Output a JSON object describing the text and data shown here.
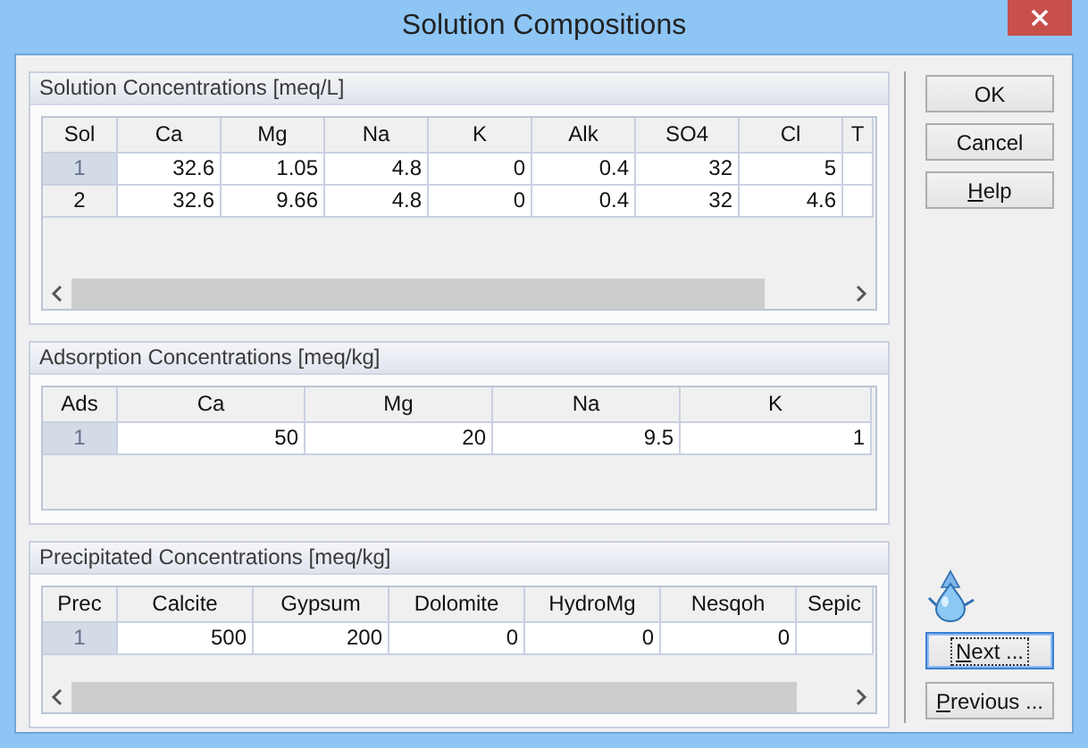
{
  "window": {
    "title": "Solution Compositions"
  },
  "panels": [
    {
      "title": "Solution Concentrations [meq/L]",
      "scrollbar": true,
      "columns": [
        "Sol",
        "Ca",
        "Mg",
        "Na",
        "K",
        "Alk",
        "SO4",
        "Cl",
        "T"
      ],
      "rows": [
        {
          "header": "1",
          "selected": true,
          "cells": [
            "32.6",
            "1.05",
            "4.8",
            "0",
            "0.4",
            "32",
            "5",
            ""
          ]
        },
        {
          "header": "2",
          "selected": false,
          "cells": [
            "32.6",
            "9.66",
            "4.8",
            "0",
            "0.4",
            "32",
            "4.6",
            ""
          ]
        }
      ]
    },
    {
      "title": "Adsorption Concentrations [meq/kg]",
      "scrollbar": false,
      "columns": [
        "Ads",
        "Ca",
        "Mg",
        "Na",
        "K"
      ],
      "rows": [
        {
          "header": "1",
          "selected": true,
          "cells": [
            "50",
            "20",
            "9.5",
            "1"
          ]
        }
      ]
    },
    {
      "title": "Precipitated Concentrations [meq/kg]",
      "scrollbar": true,
      "columns": [
        "Prec",
        "Calcite",
        "Gypsum",
        "Dolomite",
        "HydroMg",
        "Nesqoh",
        "Sepic"
      ],
      "rows": [
        {
          "header": "1",
          "selected": true,
          "cells": [
            "500",
            "200",
            "0",
            "0",
            "0",
            ""
          ]
        }
      ]
    }
  ],
  "buttons_top": [
    {
      "label": "OK",
      "mnemonic": false,
      "focused": false
    },
    {
      "label": "Cancel",
      "mnemonic": false,
      "focused": false
    },
    {
      "label": "Help",
      "mnemonic": true,
      "focused": false
    }
  ],
  "buttons_bottom": [
    {
      "label": "Next ...",
      "mnemonic": true,
      "focused": true
    },
    {
      "label": "Previous ...",
      "mnemonic": true,
      "focused": false
    }
  ]
}
